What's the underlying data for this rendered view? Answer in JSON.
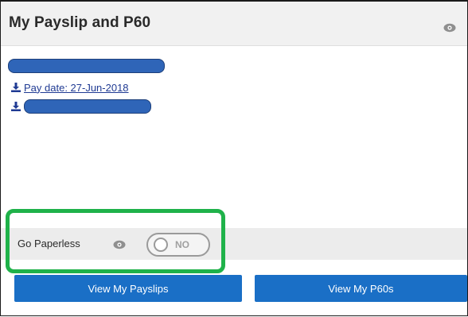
{
  "panel": {
    "title": "My Payslip and P60",
    "title_icon": "eye-icon"
  },
  "payslips": {
    "items": [
      {
        "kind": "redacted",
        "label": ""
      },
      {
        "kind": "link",
        "icon": "download-icon",
        "label": "Pay date: 27-Jun-2018"
      },
      {
        "kind": "link-redacted",
        "icon": "download-icon",
        "label": ""
      }
    ]
  },
  "paperless": {
    "label": "Go Paperless",
    "info_icon": "eye-icon",
    "toggle_state": "NO",
    "toggle_on": false
  },
  "actions": {
    "view_payslips_label": "View My Payslips",
    "view_p60s_label": "View My P60s"
  },
  "colors": {
    "title_bar_bg": "#f1f1f1",
    "link": "#1f3a93",
    "redaction": "#2f65b8",
    "button_bg": "#1a6fc6",
    "button_text": "#ffffff",
    "highlight": "#1fb24a",
    "paperless_bar_bg": "#ececec"
  }
}
